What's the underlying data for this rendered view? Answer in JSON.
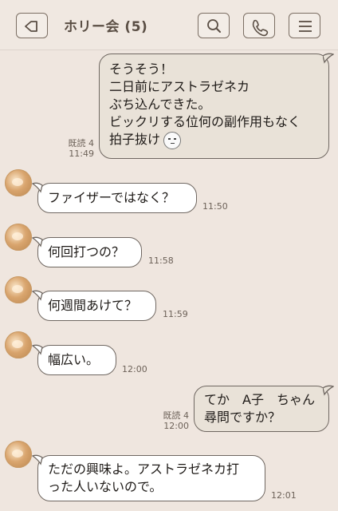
{
  "header": {
    "title": "ホリー会 (5)",
    "back_icon": "back-arrow-icon",
    "search_icon": "search-icon",
    "call_icon": "phone-icon",
    "menu_icon": "menu-icon"
  },
  "messages": [
    {
      "direction": "out",
      "lines": [
        "そうそう！",
        "二日前にアストラゼネカ",
        "ぶち込んできた。",
        "ビックリする位何の副作用もなく",
        "拍子抜け"
      ],
      "emoji": "sleepy-face-emoji",
      "read": "既読 4",
      "time": "11:49"
    },
    {
      "direction": "in",
      "lines": [
        "ファイザーではなく？"
      ],
      "time": "11:50"
    },
    {
      "direction": "in",
      "lines": [
        "何回打つの？"
      ],
      "time": "11:58"
    },
    {
      "direction": "in",
      "lines": [
        "何週間あけて？"
      ],
      "time": "11:59"
    },
    {
      "direction": "in",
      "lines": [
        "幅広い。"
      ],
      "time": "12:00"
    },
    {
      "direction": "out",
      "lines": [
        "てか　A子　ちゃん",
        "尋問ですか？"
      ],
      "read": "既読 4",
      "time": "12:00"
    },
    {
      "direction": "in",
      "lines": [
        "ただの興味よ。アストラゼネカ打",
        "った人いないので。"
      ],
      "time": "12:01"
    }
  ],
  "colors": {
    "background": "#efe6df",
    "bubble_in": "#ffffff",
    "bubble_out": "#e9e2d8",
    "border": "#6f6761"
  }
}
